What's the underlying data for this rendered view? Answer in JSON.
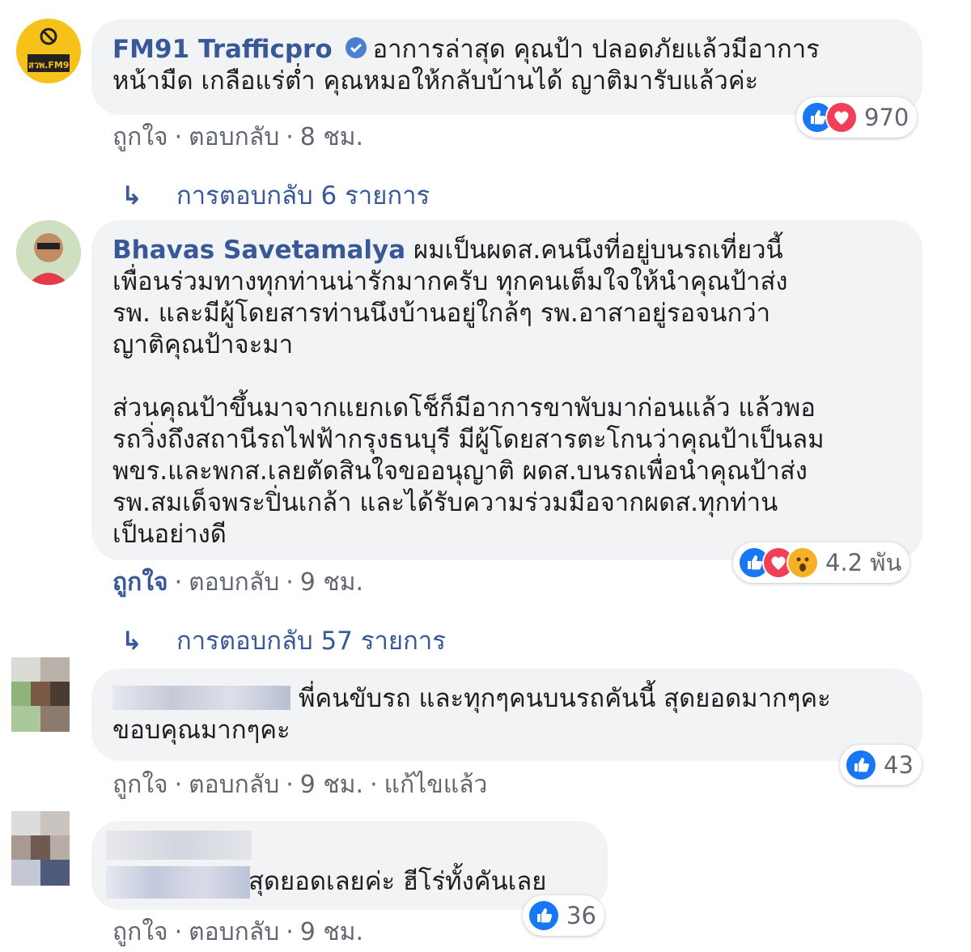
{
  "comments": [
    {
      "author": "FM91 Trafficpro",
      "avatar_text": "สวพ.FM91",
      "verified_icon": "verified-badge-icon",
      "text_line1": "อาการล่าสุด คุณป้า ปลอดภัยแล้วมีอาการ",
      "text_line2": "หน้ามืด เกลือแร่ต่ำ คุณหมอให้กลับบ้านได้ ญาติมารับแล้วค่ะ",
      "reactions": [
        "like",
        "love"
      ],
      "reaction_count": "970",
      "like_label": "ถูกใจ",
      "reply_label": "ตอบกลับ",
      "time": "8 ชม.",
      "replies_label": "การตอบกลับ 6 รายการ"
    },
    {
      "author": "Bhavas Savetamalya",
      "para1_line1": "ผมเป็นผดส.คนนึงที่อยู่บนรถเที่ยวนี้",
      "para1_line2": "เพื่อนร่วมทางทุกท่านน่ารักมากครับ ทุกคนเต็มใจให้นำคุณป้าส่ง",
      "para1_line3": "รพ. และมีผู้โดยสารท่านนึงบ้านอยู่ใกล้ๆ รพ.อาสาอยู่รอจนกว่า",
      "para1_line4": "ญาติคุณป้าจะมา",
      "para2_line1": "ส่วนคุณป้าขึ้นมาจากแยกเดโช็ก็มีอาการขาพับมาก่อนแล้ว แล้วพอ",
      "para2_line2": "รถวิ่งถึงสถานีรถไฟฟ้ากรุงธนบุรี มีผู้โดยสารตะโกนว่าคุณป้าเป็นลม",
      "para2_line3": "พขร.และพกส.เลยตัดสินใจขออนุญาติ ผดส.บนรถเพื่อนำคุณป้าส่ง",
      "para2_line4": "รพ.สมเด็จพระปิ่นเกล้า และได้รับความร่วมมือจากผดส.ทุกท่าน",
      "para2_line5": "เป็นอย่างดี",
      "reactions": [
        "like",
        "love",
        "wow"
      ],
      "reaction_count": "4.2 พัน",
      "like_label": "ถูกใจ",
      "reply_label": "ตอบกลับ",
      "time": "9 ชม.",
      "replies_label": "การตอบกลับ 57 รายการ"
    },
    {
      "text_line1": "พี่คนขับรถ และทุกๆคนบนรถคันนี้ สุดยอดมากๆคะ",
      "text_line2": "ขอบคุณมากๆคะ",
      "reactions": [
        "like"
      ],
      "reaction_count": "43",
      "like_label": "ถูกใจ",
      "reply_label": "ตอบกลับ",
      "time": "9 ชม.",
      "edited_label": "แก้ไขแล้ว"
    },
    {
      "text_line1": "สุดยอดเลยค่ะ ฮีโร่ทั้งคันเลย",
      "reactions": [
        "like"
      ],
      "reaction_count": "36",
      "like_label": "ถูกใจ",
      "reply_label": "ตอบกลับ",
      "time": "9 ชม."
    }
  ],
  "colors": {
    "bubble": "#f2f3f5",
    "author": "#385898",
    "meta": "#606770",
    "like": "#1877f2",
    "love": "#f33e58",
    "wow": "#f7b125",
    "fm91_avatar": "#f6c21a"
  }
}
